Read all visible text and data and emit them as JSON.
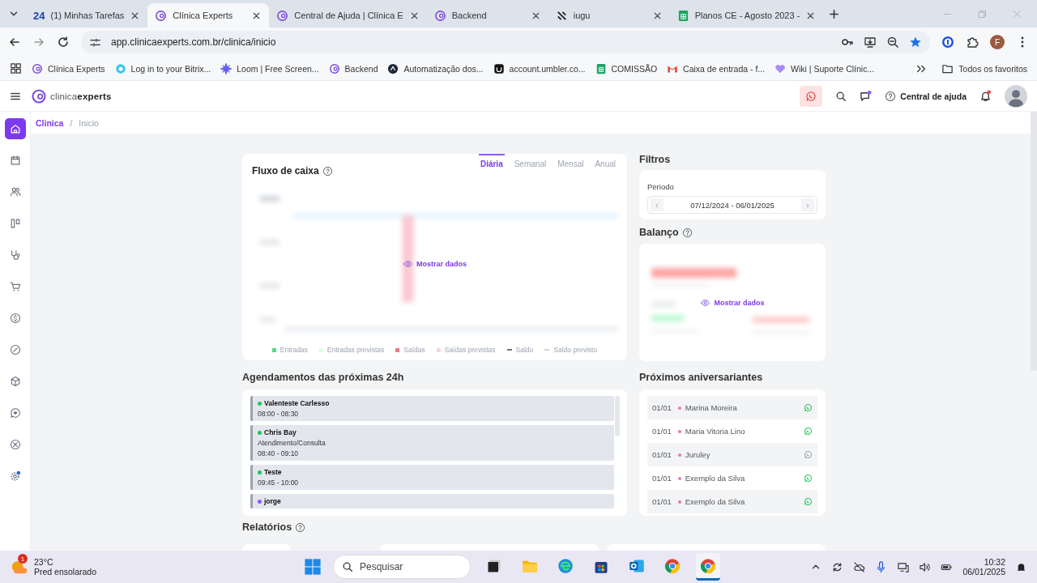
{
  "browser": {
    "tabs": [
      {
        "label": "(1) Minhas Tarefas",
        "kind": "text",
        "favicon_text": "24",
        "selected": false
      },
      {
        "label": "Clínica Experts",
        "kind": "ring",
        "selected": true
      },
      {
        "label": "Central de Ajuda | Clínica E",
        "kind": "ring",
        "selected": false
      },
      {
        "label": "Backend",
        "kind": "ring",
        "selected": false
      },
      {
        "label": "iugu",
        "kind": "slash",
        "selected": false
      },
      {
        "label": "Planos CE - Agosto 2023 -",
        "kind": "sheets",
        "selected": false
      }
    ],
    "url": "app.clinicaexperts.com.br/clinica/inicio",
    "profile": "F",
    "bookmarks": [
      {
        "label": "Clínica Experts",
        "kind": "ring"
      },
      {
        "label": "Log in to your Bitrix...",
        "kind": "bitrix"
      },
      {
        "label": "Loom | Free Screen...",
        "kind": "loom"
      },
      {
        "label": "Backend",
        "kind": "ring"
      },
      {
        "label": "Automatização dos...",
        "kind": "dark"
      },
      {
        "label": "account.umbler.co...",
        "kind": "umbler"
      },
      {
        "label": "COMISSÃO",
        "kind": "sheets"
      },
      {
        "label": "Caixa de entrada - f...",
        "kind": "gmail"
      },
      {
        "label": "Wiki | Suporte Clínic...",
        "kind": "heart"
      }
    ],
    "all_bookmarks": "Todos os favoritos"
  },
  "header": {
    "logo": "clinica**experts**",
    "help": "Central de ajuda"
  },
  "sidebar": {
    "items": [
      {
        "kind": "home",
        "selected": true
      },
      {
        "kind": "calendar",
        "selected": false
      },
      {
        "kind": "people",
        "selected": false
      },
      {
        "kind": "board",
        "selected": false
      },
      {
        "kind": "stethoscope",
        "selected": false
      },
      {
        "kind": "cart",
        "selected": false
      },
      {
        "kind": "dollar",
        "selected": false
      },
      {
        "kind": "gauge",
        "selected": false
      },
      {
        "kind": "box",
        "selected": false
      },
      {
        "kind": "chat",
        "selected": false
      },
      {
        "kind": "xcircle",
        "selected": false
      },
      {
        "kind": "gear",
        "selected": false
      }
    ]
  },
  "breadcrumb": {
    "items": [
      "Clinica",
      "Inicio"
    ],
    "separator": "/"
  },
  "cash_flow": {
    "title": "Fluxo de caixa",
    "periods": [
      {
        "label": "Diária",
        "selected": true
      },
      {
        "label": "Semanal",
        "selected": false
      },
      {
        "label": "Mensal",
        "selected": false
      },
      {
        "label": "Anual",
        "selected": false
      }
    ],
    "show_data": "Mostrar dados",
    "legend": [
      {
        "label": "Entradas",
        "kind": "square",
        "color": "#4ade80"
      },
      {
        "label": "Entradas previstas",
        "kind": "square",
        "color": "#dcfce7"
      },
      {
        "label": "Saídas",
        "kind": "square",
        "color": "#e8798f"
      },
      {
        "label": "Saídas previstas",
        "kind": "square",
        "color": "#fbd5dc"
      },
      {
        "label": "Saldo",
        "kind": "line",
        "color": "#6b7280"
      },
      {
        "label": "Saldo previsto",
        "kind": "line",
        "color": "#d1d5db"
      }
    ]
  },
  "filters": {
    "title": "Filtros",
    "period_label": "Periodo",
    "range": "07/12/2024 - 06/01/2025",
    "prev": "‹",
    "next": "›"
  },
  "balance": {
    "title": "Balanço",
    "show_data": "Mostrar dados"
  },
  "appointments": {
    "title": "Agendamentos das próximas 24h",
    "items": [
      {
        "name": "Valenteste Carlesso",
        "color": "#22c55e",
        "time": "08:00 - 08:30"
      },
      {
        "name": "Chris Bay",
        "color": "#22c55e",
        "description": "Atendimento/Consulta",
        "time": "08:40 - 09:10"
      },
      {
        "name": "Teste",
        "color": "#22c55e",
        "time": "09:45 - 10:00"
      },
      {
        "name": "jorge",
        "color": "#8b5cf6"
      }
    ]
  },
  "birthdays": {
    "title": "Próximos aniversariantes",
    "items": [
      {
        "date": "01/01",
        "name": "Marina Moreira",
        "whatsapp": true
      },
      {
        "date": "01/01",
        "name": "Maria Vitoria Lino",
        "whatsapp": true
      },
      {
        "date": "01/01",
        "name": "Juruley",
        "whatsapp": false
      },
      {
        "date": "01/01",
        "name": "Exemplo da Silva",
        "whatsapp": true
      },
      {
        "date": "01/01",
        "name": "Exemplo da Silva",
        "whatsapp": true
      }
    ]
  },
  "reports": {
    "title": "Relatórios"
  },
  "taskbar": {
    "temperature": "23°C",
    "weather": "Pred ensolarado",
    "weather_badge": "1",
    "search_placeholder": "Pesquisar",
    "apps": [
      {
        "kind": "terminal",
        "selected": false
      },
      {
        "kind": "folder",
        "selected": false
      },
      {
        "kind": "edge",
        "selected": false
      },
      {
        "kind": "store",
        "selected": false
      },
      {
        "kind": "outlook",
        "selected": false
      },
      {
        "kind": "chrome",
        "selected": false
      },
      {
        "kind": "chrome",
        "selected": true
      }
    ],
    "time": "10:32",
    "date": "06/01/2025"
  }
}
